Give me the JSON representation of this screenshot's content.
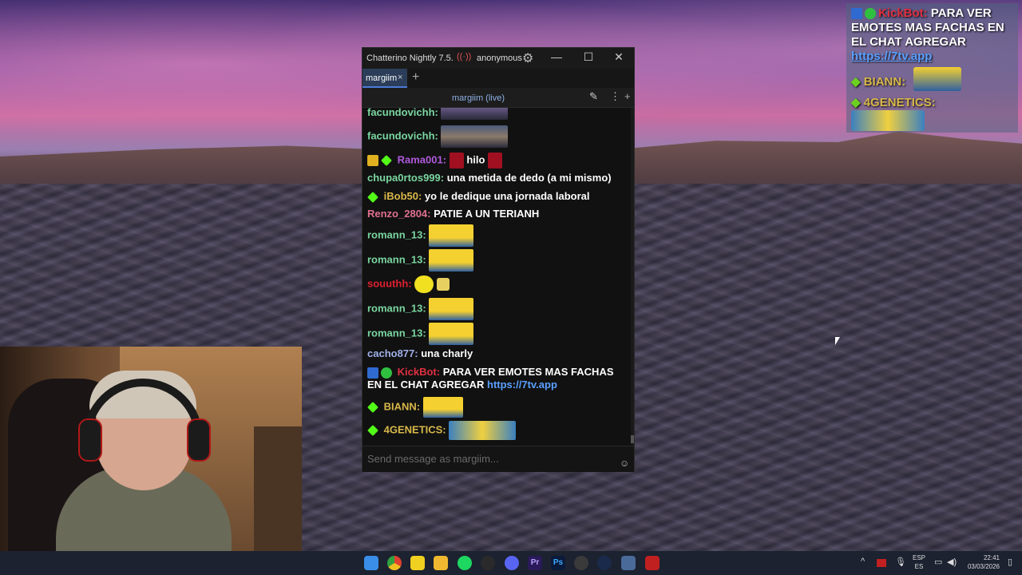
{
  "window": {
    "title": "Chatterino Nightly 7.5.4",
    "live_icon": "((·))",
    "user": "anonymous",
    "min_label": "—",
    "max_label": "☐",
    "close_label": "✕"
  },
  "tab": {
    "label": "margiim",
    "close": "×",
    "add": "+"
  },
  "split": {
    "title": "margiim (live)",
    "edit": "✎",
    "more": "⋮",
    "add": "+"
  },
  "messages": [
    {
      "user": "facundovichh:",
      "color": "#7ad6a0",
      "text": ""
    },
    {
      "user": "facundovichh:",
      "color": "#7ad6a0",
      "text": ""
    },
    {
      "user": "Rama001:",
      "color": "#b05adc",
      "text": "hilo"
    },
    {
      "user": "chupa0rtos999:",
      "color": "#7ad6a0",
      "text": "una metida de dedo (a mi mismo)"
    },
    {
      "user": "iBob50:",
      "color": "#d8b84a",
      "text": "yo le dedique una jornada laboral"
    },
    {
      "user": "Renzo_2804:",
      "color": "#e07090",
      "text": "PATIE A UN TERIANH"
    },
    {
      "user": "romann_13:",
      "color": "#7ad6a0",
      "text": ""
    },
    {
      "user": "romann_13:",
      "color": "#7ad6a0",
      "text": ""
    },
    {
      "user": "souuthh:",
      "color": "#e02030",
      "text": ""
    },
    {
      "user": "romann_13:",
      "color": "#7ad6a0",
      "text": ""
    },
    {
      "user": "romann_13:",
      "color": "#7ad6a0",
      "text": ""
    },
    {
      "user": "cacho877:",
      "color": "#a0b0e8",
      "text": "una charly"
    },
    {
      "user": "KickBot:",
      "color": "#e03040",
      "text": "PARA VER EMOTES MAS FACHAS",
      "text2": "EN EL CHAT AGREGAR",
      "link": "https://7tv.app"
    },
    {
      "user": "BIANN:",
      "color": "#d8b84a",
      "text": ""
    },
    {
      "user": "4GENETICS:",
      "color": "#d8b84a",
      "text": ""
    }
  ],
  "input": {
    "placeholder": "Send message as margiim...",
    "emoji": "☺"
  },
  "overlay": {
    "user": "KickBot:",
    "text1": "PARA VER",
    "text2": "EMOTES MAS FACHAS EN",
    "text3": "EL CHAT AGREGAR",
    "link": "https://7tv.app",
    "user2": "BIANN:",
    "user3": "4GENETICS:"
  },
  "taskbar": {
    "lang1": "ESP",
    "lang2": "ES",
    "time": "22:41",
    "date": "03/03/2026",
    "icons": [
      "windows-start-icon",
      "chrome-icon",
      "sticky-notes-icon",
      "file-explorer-icon",
      "spotify-icon",
      "obs-icon",
      "discord-icon",
      "premiere-icon",
      "photoshop-icon",
      "clock-app-icon",
      "steam-icon",
      "chatterino-icon",
      "stream-app-icon"
    ]
  },
  "colors": {
    "accent": "#4b7bd8",
    "kick_green": "#53fc18"
  }
}
